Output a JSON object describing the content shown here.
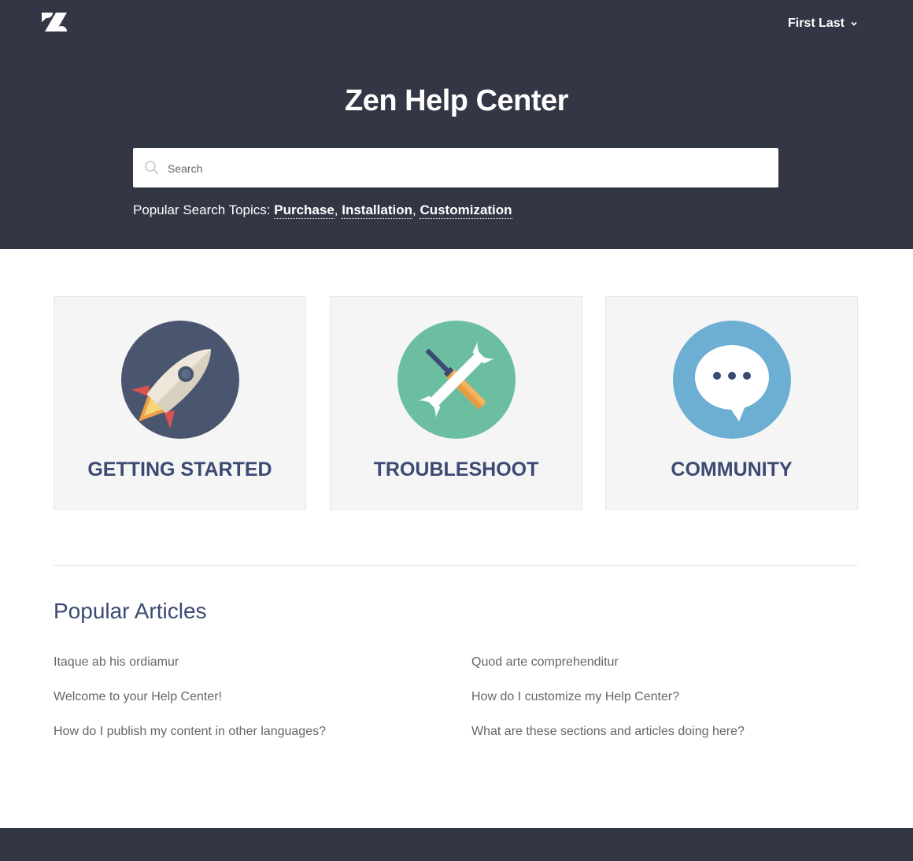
{
  "header": {
    "user_name": "First Last"
  },
  "hero": {
    "title": "Zen Help Center",
    "search_placeholder": "Search",
    "popular_prefix": "Popular Search Topics:",
    "topics": [
      "Purchase",
      "Installation",
      "Customization"
    ]
  },
  "categories": [
    {
      "label": "GETTING STARTED",
      "icon": "rocket-icon"
    },
    {
      "label": "TROUBLESHOOT",
      "icon": "tools-icon"
    },
    {
      "label": "COMMUNITY",
      "icon": "chat-bubble-icon"
    }
  ],
  "popular_articles": {
    "title": "Popular Articles",
    "left": [
      "Itaque ab his ordiamur",
      "Welcome to your Help Center!",
      "How do I publish my content in other languages?"
    ],
    "right": [
      "Quod arte comprehenditur",
      "How do I customize my Help Center?",
      "What are these sections and articles doing here?"
    ]
  },
  "colors": {
    "header_bg": "#333645",
    "accent_text": "#3c4a73",
    "card_bg": "#f5f5f5",
    "rocket_circle": "#4a5570",
    "tools_circle": "#6bbfa0",
    "chat_circle": "#6daed3"
  }
}
